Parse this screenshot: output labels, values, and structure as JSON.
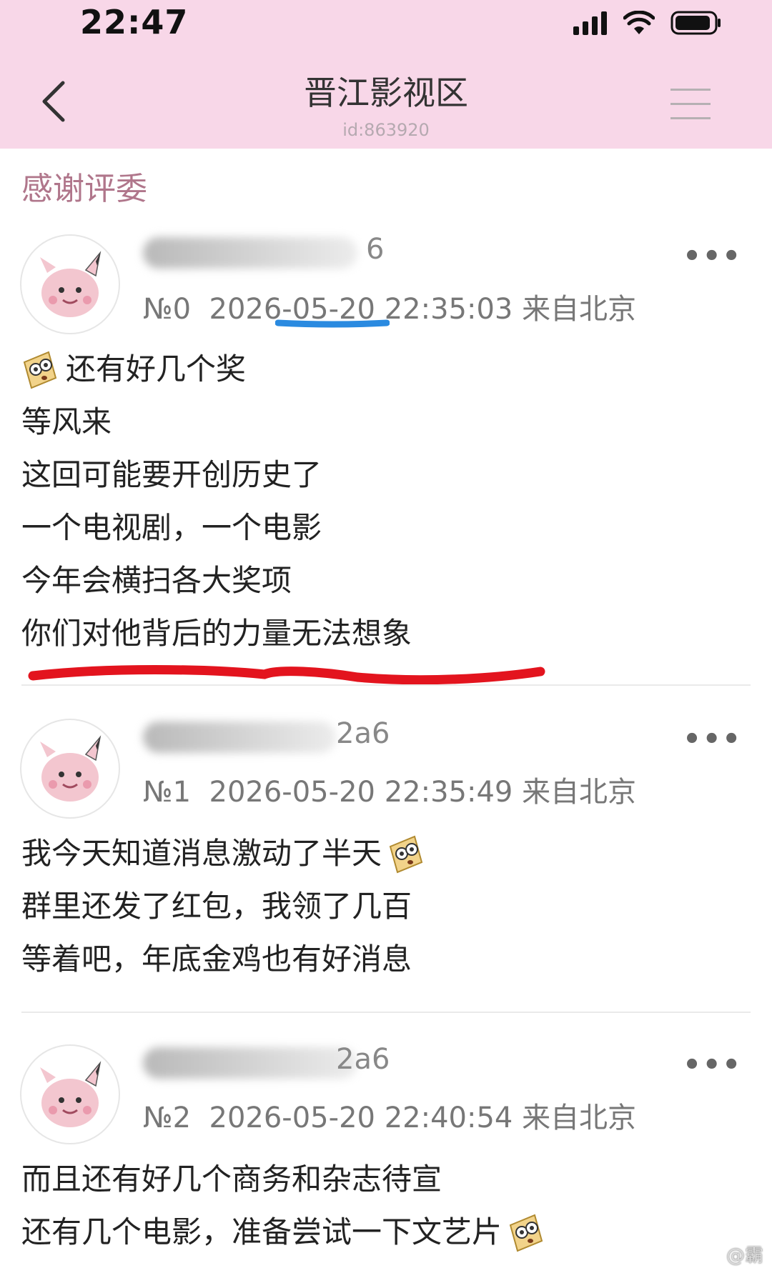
{
  "status_bar": {
    "time": "22:47"
  },
  "nav": {
    "title": "晋江影视区",
    "subtitle": "id:863920"
  },
  "section_title": "感谢评委",
  "posts": [
    {
      "user_suffix": "6",
      "floor": "№0",
      "date": "2026-05-20",
      "time": "22:35:03",
      "location": "来自北京",
      "more": "•••",
      "lines": [
        "还有好几个奖",
        "等风来",
        "这回可能要开创历史了",
        "一个电视剧，一个电影",
        "今年会横扫各大奖项",
        "你们对他背后的力量无法想象"
      ]
    },
    {
      "user_suffix": "2a6",
      "floor": "№1",
      "date": "2026-05-20",
      "time": "22:35:49",
      "location": "来自北京",
      "more": "•••",
      "lines": [
        "我今天知道消息激动了半天",
        "群里还发了红包，我领了几百",
        "等着吧，年底金鸡也有好消息"
      ]
    },
    {
      "user_suffix": "2a6",
      "floor": "№2",
      "date": "2026-05-20",
      "time": "22:40:54",
      "location": "来自北京",
      "more": "•••",
      "lines": [
        "而且还有好几个商务和杂志待宣",
        "还有几个电影，准备尝试一下文艺片"
      ]
    }
  ],
  "annotation_colors": {
    "blue_underline": "#2a8ae0",
    "red_underline": "#e3141e"
  },
  "watermark": "@霸"
}
